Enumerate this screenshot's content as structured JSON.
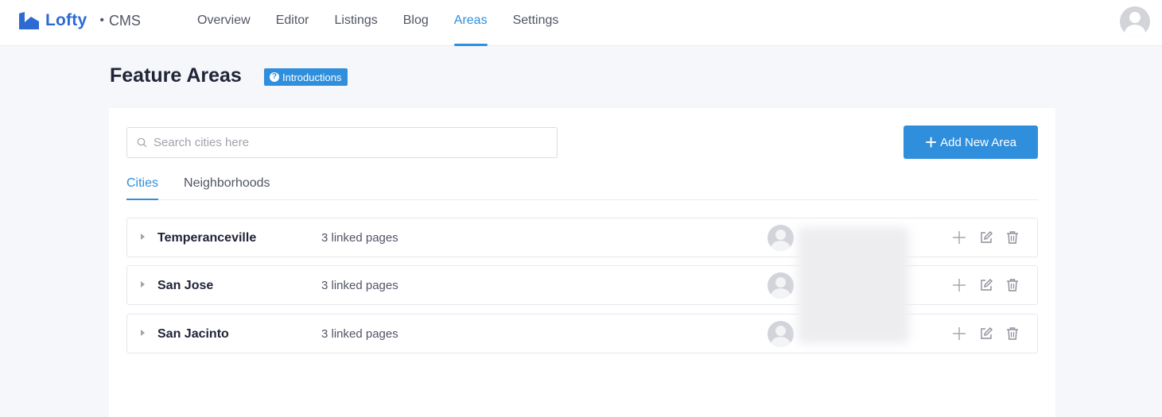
{
  "brand": {
    "name": "Lofty",
    "separator": "•",
    "product": "CMS",
    "color": "#2d6ad4"
  },
  "nav": {
    "items": [
      {
        "label": "Overview"
      },
      {
        "label": "Editor"
      },
      {
        "label": "Listings"
      },
      {
        "label": "Blog"
      },
      {
        "label": "Areas",
        "active": true
      },
      {
        "label": "Settings"
      }
    ]
  },
  "page": {
    "title": "Feature Areas",
    "badge": "Introductions"
  },
  "search": {
    "placeholder": "Search cities here",
    "value": ""
  },
  "actions": {
    "add_label": "Add New Area"
  },
  "tabs": [
    {
      "label": "Cities",
      "active": true
    },
    {
      "label": "Neighborhoods"
    }
  ],
  "areas": [
    {
      "name": "Temperanceville",
      "linked": "3 linked pages"
    },
    {
      "name": "San Jose",
      "linked": "3 linked pages"
    },
    {
      "name": "San Jacinto",
      "linked": "3 linked pages"
    }
  ],
  "colors": {
    "accent": "#2f8fdc",
    "text": "#202437",
    "muted": "#515666",
    "background": "#f6f7fb"
  },
  "icons": [
    "search-icon",
    "question-icon",
    "plus-icon",
    "caret-right-icon",
    "edit-icon",
    "trash-icon",
    "avatar-icon"
  ]
}
